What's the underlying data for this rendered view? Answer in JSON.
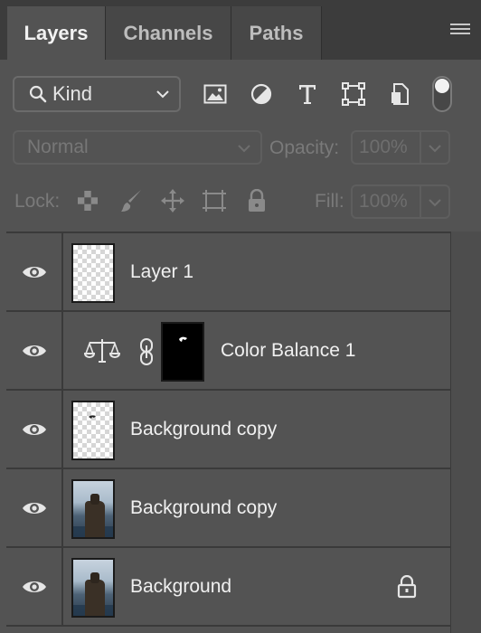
{
  "tabs": [
    {
      "label": "Layers",
      "active": true
    },
    {
      "label": "Channels",
      "active": false
    },
    {
      "label": "Paths",
      "active": false
    }
  ],
  "filter": {
    "kind_label": "Kind"
  },
  "blend": {
    "mode": "Normal",
    "opacity_label": "Opacity:",
    "opacity_value": "100%"
  },
  "lock": {
    "label": "Lock:",
    "fill_label": "Fill:",
    "fill_value": "100%"
  },
  "layers": [
    {
      "name": "Layer 1",
      "visible": true,
      "thumbnail": "transparent"
    },
    {
      "name": "Color Balance 1",
      "visible": true,
      "thumbnail": "adjustment-mask"
    },
    {
      "name": "Background copy",
      "visible": true,
      "thumbnail": "transparent-with-bird"
    },
    {
      "name": "Background copy",
      "visible": true,
      "thumbnail": "photo"
    },
    {
      "name": "Background",
      "visible": true,
      "thumbnail": "photo",
      "locked": true
    }
  ],
  "colors": {
    "panel_bg": "#535353",
    "tab_bar_bg": "#3c3c3c",
    "divider": "#3a3a3a",
    "text": "#f0f0f0",
    "disabled_text": "#7a7a7a"
  }
}
